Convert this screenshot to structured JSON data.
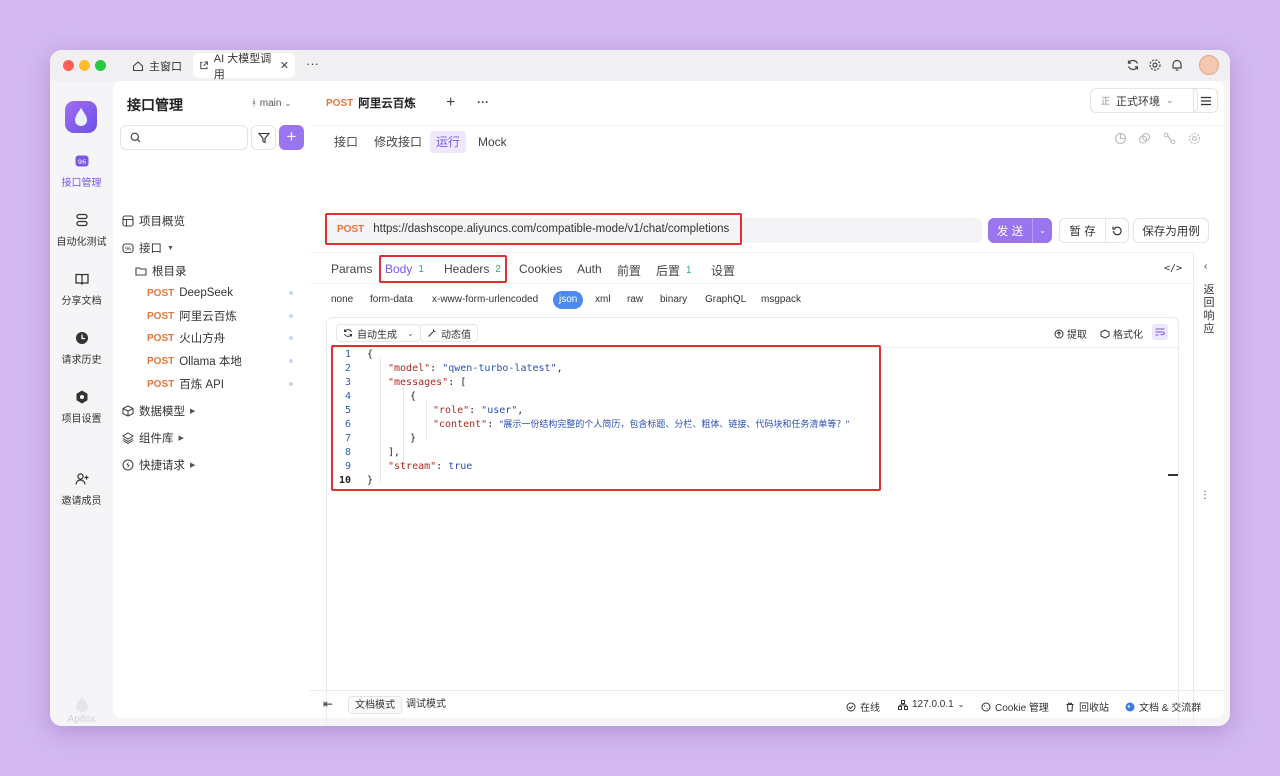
{
  "titlebar": {
    "home_tab": "主窗口",
    "active_tab": "AI 大模型调用",
    "more": "···"
  },
  "rail": {
    "items": [
      {
        "label": "接口管理",
        "icon": "api-icon"
      },
      {
        "label": "自动化测试",
        "icon": "automation-icon"
      },
      {
        "label": "分享文档",
        "icon": "book-icon"
      },
      {
        "label": "请求历史",
        "icon": "clock-icon"
      },
      {
        "label": "项目设置",
        "icon": "settings-icon"
      },
      {
        "label": "邀请成员",
        "icon": "add-user-icon"
      }
    ],
    "footer_brand": "Apifox"
  },
  "sidebar": {
    "title": "接口管理",
    "branch": "main",
    "tree": {
      "overview": "项目概览",
      "api": "接口",
      "root": "根目录",
      "endpoints": [
        {
          "method": "POST",
          "name": "DeepSeek"
        },
        {
          "method": "POST",
          "name": "阿里云百炼"
        },
        {
          "method": "POST",
          "name": "火山方舟"
        },
        {
          "method": "POST",
          "name": "Ollama 本地"
        },
        {
          "method": "POST",
          "name": "百炼 API"
        }
      ],
      "data_model": "数据模型",
      "components": "组件库",
      "quick_request": "快捷请求"
    }
  },
  "main": {
    "request_tab": {
      "method": "POST",
      "name": "阿里云百炼"
    },
    "environment": {
      "badge": "正",
      "label": "正式环境"
    },
    "subtabs": [
      "接口",
      "修改接口",
      "运行",
      "Mock"
    ],
    "active_subtab": "运行",
    "url": {
      "method": "POST",
      "value": "https://dashscope.aliyuncs.com/compatible-mode/v1/chat/completions"
    },
    "send_label": "发 送",
    "save_temp_label": "暂 存",
    "save_case_label": "保存为用例",
    "param_tabs": [
      {
        "label": "Params",
        "count": ""
      },
      {
        "label": "Body",
        "count": "1"
      },
      {
        "label": "Headers",
        "count": "2"
      },
      {
        "label": "Cookies",
        "count": ""
      },
      {
        "label": "Auth",
        "count": ""
      },
      {
        "label": "前置",
        "count": ""
      },
      {
        "label": "后置",
        "count": "1"
      },
      {
        "label": "设置",
        "count": ""
      }
    ],
    "body_types": [
      "none",
      "form-data",
      "x-www-form-urlencoded",
      "json",
      "xml",
      "raw",
      "binary",
      "GraphQL",
      "msgpack"
    ],
    "active_body_type": "json",
    "editor_toolbar": {
      "auto_generate": "自动生成",
      "dynamic_value": "动态值",
      "extract": "提取",
      "format": "格式化"
    },
    "code_lines": [
      {
        "n": "1",
        "text": "{"
      },
      {
        "n": "2",
        "key": "\"model\"",
        "value": "\"qwen-turbo-latest\"",
        "tail": ","
      },
      {
        "n": "3",
        "key": "\"messages\"",
        "tail": ": ["
      },
      {
        "n": "4",
        "text": "{"
      },
      {
        "n": "5",
        "key": "\"role\"",
        "value": "\"user\"",
        "tail": ","
      },
      {
        "n": "6",
        "key": "\"content\"",
        "value": "\"展示一份结构完整的个人简历，包含标题、分栏、粗体、链接、代码块和任务清单等？\"",
        "tail": ""
      },
      {
        "n": "7",
        "text": "}"
      },
      {
        "n": "8",
        "text": "],"
      },
      {
        "n": "9",
        "key": "\"stream\"",
        "value": "true",
        "tail": ""
      },
      {
        "n": "10",
        "text": "}"
      }
    ],
    "right_panel_label": "返回响应"
  },
  "footer": {
    "doc_mode": "文档模式",
    "debug_mode": "调试模式",
    "online": "在线",
    "ip": "127.0.0.1",
    "cookie": "Cookie 管理",
    "recycle": "回收站",
    "docs": "文档 & 交流群"
  },
  "colors": {
    "accent": "#9b74ef",
    "method_post": "#e8743b",
    "highlight_box": "#e03131",
    "json_active": "#4d8af0"
  }
}
